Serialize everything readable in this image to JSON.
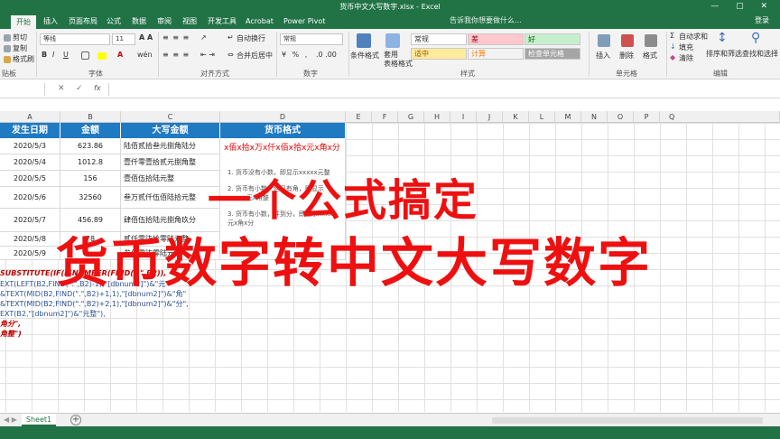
{
  "window": {
    "title": "货币中文大写数字.xlsx - Excel",
    "controls": "— ▢ ✕"
  },
  "ribbon_tabs": [
    "开始",
    "插入",
    "页面布局",
    "公式",
    "数据",
    "审阅",
    "视图",
    "开发工具",
    "Acrobat",
    "Power Pivot"
  ],
  "tellme": "告诉我你想要做什么...",
  "login": "登录",
  "ribbon": {
    "clipboard": {
      "cut": "剪切",
      "copy": "复制",
      "painter": "格式刷",
      "label": "贴板"
    },
    "font": {
      "name": "等线",
      "size": "11",
      "label": "字体"
    },
    "alignment": {
      "wrap": "自动换行",
      "merge": "合并后居中",
      "label": "对齐方式"
    },
    "number": {
      "format": "常规",
      "label": "数字"
    },
    "styles": {
      "cond": "条件格式",
      "table": "套用\n表格格式",
      "cells": [
        {
          "text": "常规",
          "bg": "#ffffff",
          "fg": "#333333"
        },
        {
          "text": "差",
          "bg": "#ffc7ce",
          "fg": "#9c0006"
        },
        {
          "text": "好",
          "bg": "#c6efce",
          "fg": "#006100"
        },
        {
          "text": "适中",
          "bg": "#ffeb9c",
          "fg": "#9c5700"
        },
        {
          "text": "计算",
          "bg": "#f2f2f2",
          "fg": "#fa7d00"
        },
        {
          "text": "检查单元格",
          "bg": "#a5a5a5",
          "fg": "#ffffff"
        }
      ],
      "label": "样式"
    },
    "cellsgrp": {
      "insert": "插入",
      "delete": "删除",
      "format": "格式",
      "label": "单元格"
    },
    "editing": {
      "autosum": "自动求和",
      "fill": "填充",
      "clear": "清除",
      "sort": "排序和筛选",
      "find": "查找和选择",
      "label": "编辑"
    }
  },
  "formula_bar": {
    "cancel": "✕",
    "confirm": "✓",
    "fx": "fx"
  },
  "columns": [
    "A",
    "B",
    "C",
    "D",
    "E",
    "F",
    "G",
    "H",
    "I",
    "J",
    "K",
    "L",
    "M",
    "N",
    "O",
    "P",
    "Q"
  ],
  "table_headers": [
    "发生日期",
    "金额",
    "大写金额",
    "货币格式"
  ],
  "rows": [
    {
      "date": "2020/5/3",
      "amount": "623.86",
      "upper": "陆佰贰拾叁元捌角陆分"
    },
    {
      "date": "2020/5/4",
      "amount": "1012.8",
      "upper": "壹仟零壹拾贰元捌角整"
    },
    {
      "date": "2020/5/5",
      "amount": "156",
      "upper": "壹佰伍拾陆元整"
    },
    {
      "date": "2020/5/6",
      "amount": "32560",
      "upper": "叁万贰仟伍佰陆拾元整"
    },
    {
      "date": "2020/5/7",
      "amount": "456.89",
      "upper": "肆佰伍拾陆元捌角玖分"
    },
    {
      "date": "2020/5/8",
      "amount": "78",
      "upper": "贰仟零柒拾零陆元整"
    },
    {
      "date": "2020/5/9",
      "amount": "",
      "upper": "叁仟零柒零陆元整"
    }
  ],
  "currency_note": {
    "header": "x佰x拾x万x仟x佰x拾x元x角x分",
    "n1": "1. 货币没有小数，即显示xxxxx元整",
    "n2": "2. 货币有小数，但只有角，即显示xxxxx元x角整",
    "n3": "3. 货币有小数，并到分，即显示xxxxx元x角x分"
  },
  "formula_lines": [
    "SUBSTITUTE(IF(ISNUMBER(FIND(\".\",B2)),",
    "EXT(LEFT(B2,FIND(\".\",B2)-1),\"[dbnum2]\")&\"元\"",
    "&TEXT(MID(B2,FIND(\".\",B2)+1,1),\"[dbnum2]\")&\"角\"",
    "&TEXT(MID(B2,FIND(\".\",B2)+2,1),\"[dbnum2]\")&\"分\",",
    "EXT(B2,\"[dbnum2]\")&\"元整\"),",
    "角分\",",
    "角整\")"
  ],
  "overlay": {
    "line1": "一个公式搞定",
    "line2": "货币数字转中文大写数字"
  },
  "sheet_tab": "Sheet1",
  "add_sheet": "+"
}
